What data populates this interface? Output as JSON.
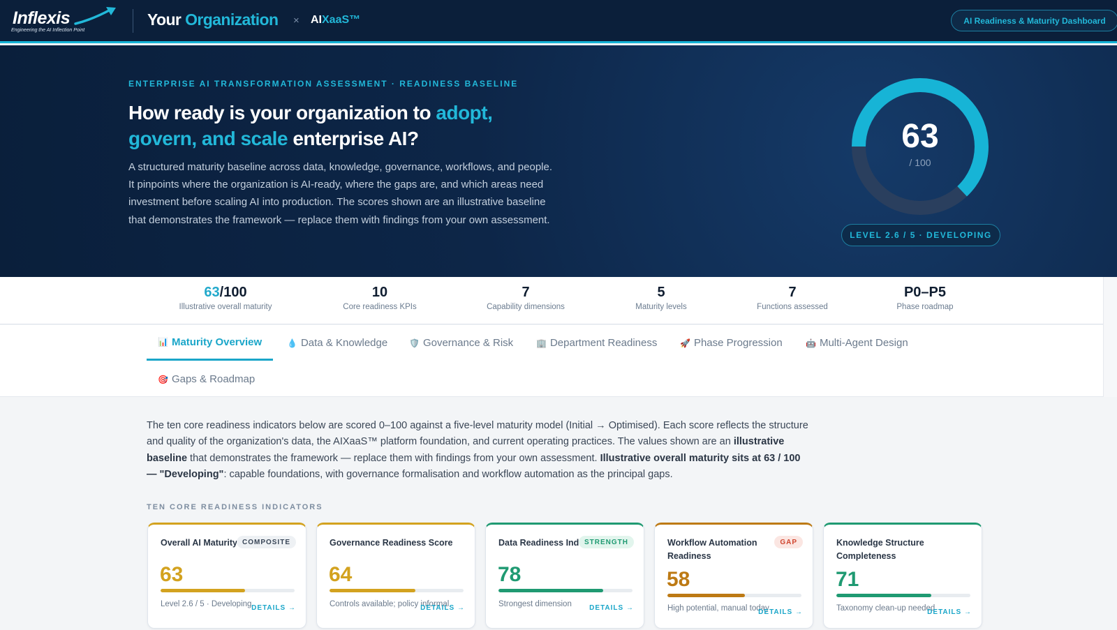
{
  "header": {
    "logo_text": "Inflexis",
    "logo_tagline": "Engineering the AI Inflection Point",
    "org_your": "Your",
    "org_name": "Organization",
    "times": "×",
    "product_ai": "AI",
    "product_xaas": "XaaS™",
    "dashboard_pill": "AI Readiness & Maturity Dashboard",
    "accent_color": "#22b8d9"
  },
  "hero": {
    "eyebrow": "ENTERPRISE AI TRANSFORMATION ASSESSMENT · READINESS BASELINE",
    "title_part1": "How ready is your organization to ",
    "title_accent": "adopt, govern, and scale",
    "title_part2": " enterprise AI?",
    "description": "A structured maturity baseline across data, knowledge, governance, workflows, and people. It pinpoints where the organization is AI-ready, where the gaps are, and which areas need investment before scaling AI into production. The scores shown are an illustrative baseline that demonstrates the framework — replace them with findings from your own assessment.",
    "gauge": {
      "score": "63",
      "out_of": "/ 100",
      "fraction": 0.63
    },
    "level_pill": "LEVEL 2.6 / 5 · DEVELOPING"
  },
  "stats": [
    {
      "value_accent": "63",
      "value": "/100",
      "label": "Illustrative overall maturity"
    },
    {
      "value_accent": "",
      "value": "10",
      "label": "Core readiness KPIs"
    },
    {
      "value_accent": "",
      "value": "7",
      "label": "Capability dimensions"
    },
    {
      "value_accent": "",
      "value": "5",
      "label": "Maturity levels"
    },
    {
      "value_accent": "",
      "value": "7",
      "label": "Functions assessed"
    },
    {
      "value_accent": "",
      "value": "P0–P5",
      "label": "Phase roadmap"
    }
  ],
  "tabs": [
    {
      "icon": "📊",
      "label": "Maturity Overview",
      "active": true
    },
    {
      "icon": "💧",
      "label": "Data & Knowledge"
    },
    {
      "icon": "🛡️",
      "label": "Governance & Risk"
    },
    {
      "icon": "🏢",
      "label": "Department Readiness"
    },
    {
      "icon": "🚀",
      "label": "Phase Progression"
    },
    {
      "icon": "🤖",
      "label": "Multi-Agent Design"
    },
    {
      "icon": "🎯",
      "label": "Gaps & Roadmap"
    }
  ],
  "intro": {
    "p1": "The ten core readiness indicators below are scored 0–100 against a five-level maturity model (Initial → Optimised). Each score reflects the structure and quality of the organization's data, the AIXaaS™ platform foundation, and current operating practices. The values shown are an ",
    "b1": "illustrative baseline",
    "p2": " that demonstrates the framework — replace them with findings from your own assessment. ",
    "b2": "Illustrative overall maturity sits at 63 / 100 — \"Developing\"",
    "p3": ": capable foundations, with governance formalisation and workflow automation as the principal gaps."
  },
  "section_label": "TEN CORE READINESS INDICATORS",
  "cards": [
    {
      "title": "Overall AI Maturity Score",
      "badge": "COMPOSITE",
      "score": "63",
      "fraction": 0.63,
      "note": "Level 2.6 / 5 · Developing",
      "link": "DETAILS →",
      "color": "#d3a21f"
    },
    {
      "title": "Governance Readiness Score",
      "badge": "",
      "score": "64",
      "fraction": 0.64,
      "note": "Controls available; policy informal",
      "link": "DETAILS →",
      "color": "#d3a21f"
    },
    {
      "title": "Data Readiness Index",
      "badge": "STRENGTH",
      "score": "78",
      "fraction": 0.78,
      "note": "Strongest dimension",
      "link": "DETAILS →",
      "color": "#1f9a72"
    },
    {
      "title": "Workflow Automation Readiness",
      "badge": "GAP",
      "score": "58",
      "fraction": 0.58,
      "note": "High potential, manual today",
      "link": "DETAILS →",
      "color": "#bd7a14"
    },
    {
      "title": "Knowledge Structure Completeness",
      "badge": "",
      "score": "71",
      "fraction": 0.71,
      "note": "Taxonomy clean-up needed",
      "link": "DETAILS →",
      "color": "#1f9a72"
    }
  ]
}
